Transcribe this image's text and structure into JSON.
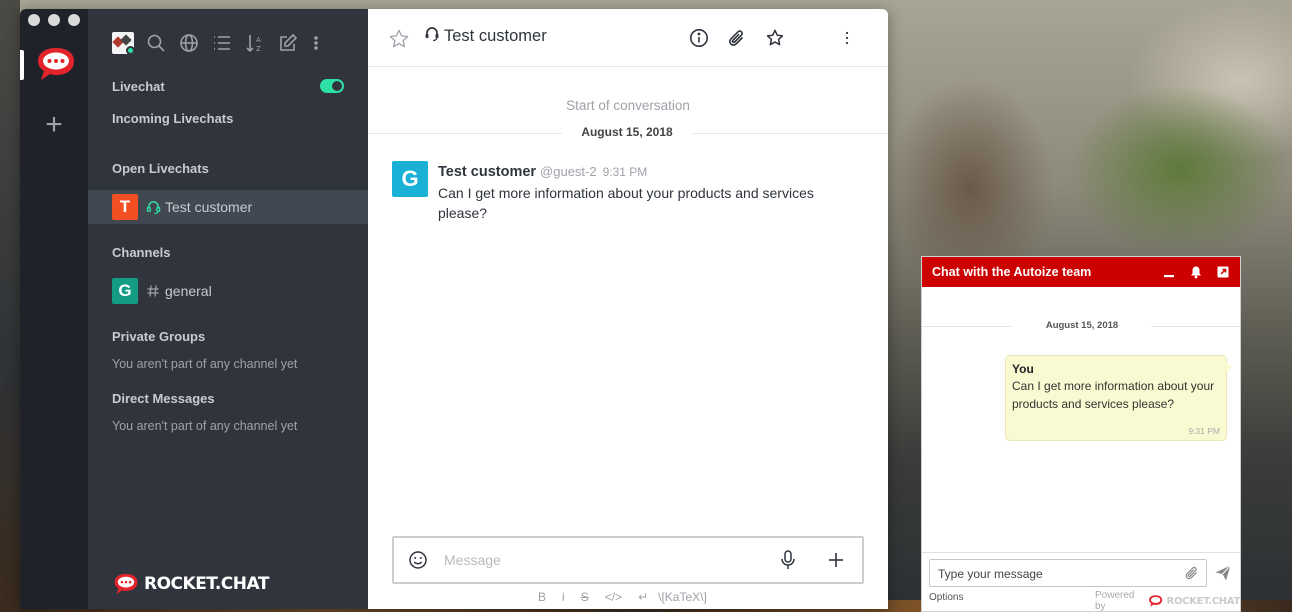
{
  "colors": {
    "rocket_red": "#e3242b",
    "livechat_green": "#2de0a5",
    "sidebar_bg": "#2f343d",
    "server_bg": "#1f2329",
    "widget_header": "#cc0000",
    "avatar_T": "#f5455c",
    "avatar_G_room": "#159c85",
    "avatar_G_msg": "#1bb1d6"
  },
  "sidebar": {
    "toolbar_icons": [
      "avatar",
      "search-icon",
      "globe-icon",
      "list-icon",
      "sort-icon",
      "edit-icon",
      "kebab-icon"
    ],
    "livechat_label": "Livechat",
    "livechat_enabled": true,
    "incoming_label": "Incoming Livechats",
    "open_label": "Open Livechats",
    "open_rooms": [
      {
        "avatar_letter": "T",
        "name": "Test customer",
        "icon": "livechat-icon"
      }
    ],
    "channels_label": "Channels",
    "channels": [
      {
        "avatar_letter": "G",
        "name": "general",
        "icon": "hash-icon"
      }
    ],
    "private_groups_label": "Private Groups",
    "private_groups_empty": "You aren't part of any channel yet",
    "direct_messages_label": "Direct Messages",
    "direct_messages_empty": "You aren't part of any channel yet",
    "brand": "ROCKET.CHAT"
  },
  "room": {
    "title": "Test customer",
    "start_label": "Start of conversation",
    "date_label": "August 15, 2018",
    "message": {
      "avatar_letter": "G",
      "user": "Test customer",
      "handle": "@guest-2",
      "time": "9:31 PM",
      "text": "Can I get more information about your products and services please?"
    },
    "composer_placeholder": "Message",
    "format_bar": [
      "B",
      "i",
      "S",
      "</>",
      "↵",
      "\\[KaTeX\\]"
    ]
  },
  "widget": {
    "title": "Chat with the Autoize team",
    "date_label": "August 15, 2018",
    "message": {
      "author": "You",
      "text": "Can I get more information about your products and services please?",
      "time": "9:31 PM"
    },
    "input_placeholder": "Type your message",
    "options_label": "Options",
    "powered_by": "Powered by",
    "powered_brand": "ROCKET.CHAT"
  }
}
